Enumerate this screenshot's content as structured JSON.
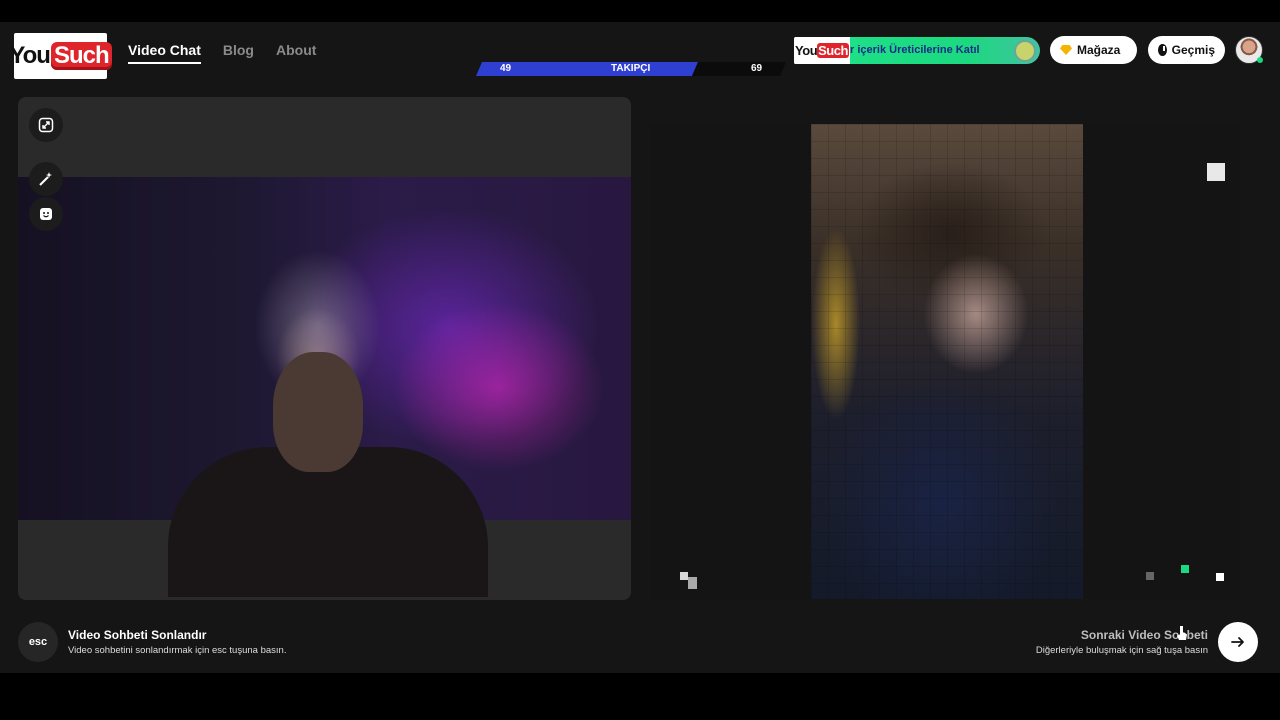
{
  "header": {
    "logo": {
      "part1": "You",
      "part2": "Such"
    },
    "nav": [
      {
        "label": "Video Chat",
        "active": true
      },
      {
        "label": "Blog",
        "active": false
      },
      {
        "label": "About",
        "active": false
      }
    ],
    "followers": {
      "left": "49",
      "label": "TAKIPÇI",
      "right": "69"
    },
    "banner": {
      "logo_part1": "You",
      "logo_part2": "Such",
      "text": "r içerik Üreticilerine Katıl"
    },
    "store_label": "Mağaza",
    "history_label": "Geçmiş",
    "icons": {
      "store": "gem-icon",
      "history": "clock-icon",
      "avatar": "user-avatar"
    }
  },
  "left_panel": {
    "tools": [
      {
        "name": "expand-icon"
      },
      {
        "name": "magic-wand-icon"
      },
      {
        "name": "emoji-icon"
      }
    ]
  },
  "footer": {
    "esc_key": "esc",
    "end_title": "Video Sohbeti Sonlandır",
    "end_sub": "Video sohbetini sonlandırmak için esc tuşuna basın.",
    "next_title": "Sonraki Video Sohbeti",
    "next_sub": "Diğerleriyle buluşmak için sağ tuşa basın"
  },
  "colors": {
    "accent_green": "#1bd97f",
    "follow_blue": "#2f3fd1",
    "brand_red": "#e0242b"
  }
}
